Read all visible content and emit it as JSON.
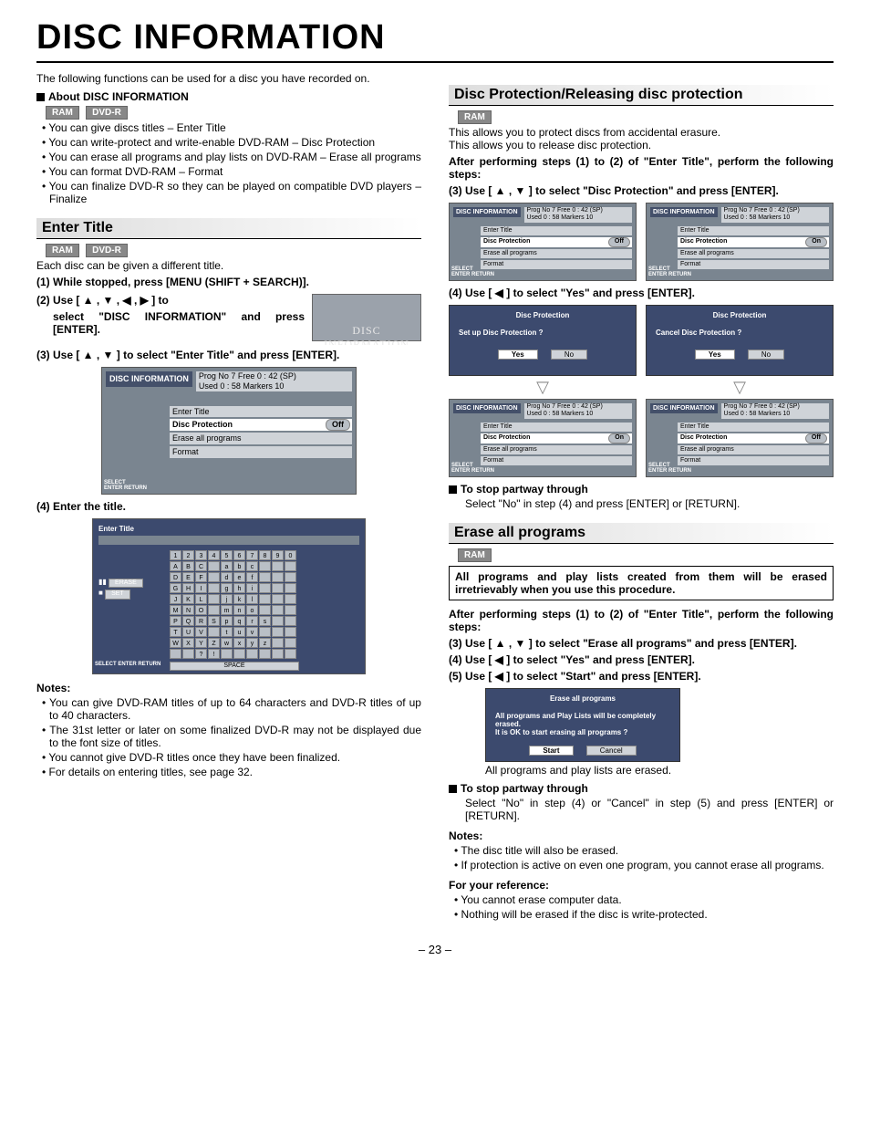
{
  "title": "DISC INFORMATION",
  "intro": "The following functions can be used for a disc you have recorded on.",
  "badges": {
    "ram": "RAM",
    "dvdr": "DVD-R"
  },
  "about": {
    "head": "About DISC INFORMATION",
    "items": [
      "You can give discs titles – Enter Title",
      "You can write-protect and write-enable DVD-RAM – Disc Protection",
      "You can erase all programs and play lists on DVD-RAM – Erase all programs",
      "You can format DVD-RAM – Format",
      "You can finalize DVD-R so they can be played on compatible DVD players – Finalize"
    ]
  },
  "enterTitle": {
    "head": "Enter Title",
    "lead": "Each disc can be given a different title.",
    "s1": "(1) While stopped, press [MENU (SHIFT + SEARCH)].",
    "s2a": "(2) Use [ ▲ , ▼ , ◀ , ▶ ] to",
    "s2b": "select \"DISC INFORMATION\" and press [ENTER].",
    "s3": "(3) Use [ ▲ , ▼ ] to select \"Enter Title\" and press [ENTER].",
    "s4": "(4) Enter the title.",
    "iconLabel": "DISC INFORMATION",
    "notesH": "Notes:",
    "notes": [
      "You can give DVD-RAM titles of up to 64 characters and DVD-R titles of up to 40 characters.",
      "The 31st letter or later on some finalized DVD-R may not be displayed due to the font size of titles.",
      "You cannot give DVD-R titles once they have been finalized.",
      "For details on entering titles, see page 32."
    ]
  },
  "menu": {
    "tag": "DISC INFORMATION",
    "stats1": "Prog No 7      Free        0 : 42 (SP)",
    "stats2": "Used    0 : 58   Markers     10",
    "rows": {
      "enterTitle": "Enter Title",
      "discProt": "Disc Protection",
      "eraseAll": "Erase all programs",
      "format": "Format"
    },
    "off": "Off",
    "on": "On",
    "side": "SELECT\nENTER  RETURN"
  },
  "kb": {
    "title": "Enter Title",
    "erase": "ERASE",
    "set": "SET",
    "space": "SPACE",
    "side": "SELECT\nENTER  RETURN",
    "row1": [
      "1",
      "2",
      "3",
      "4",
      "5",
      "6",
      "7",
      "8",
      "9",
      "0"
    ],
    "row2": [
      "A",
      "B",
      "C",
      "",
      "a",
      "b",
      "c",
      "",
      "",
      ""
    ],
    "row3": [
      "D",
      "E",
      "F",
      "",
      "d",
      "e",
      "f",
      "",
      "",
      ""
    ],
    "row4": [
      "G",
      "H",
      "I",
      "",
      "g",
      "h",
      "i",
      "",
      "",
      ""
    ],
    "row5": [
      "J",
      "K",
      "L",
      "",
      "j",
      "k",
      "l",
      "",
      "",
      ""
    ],
    "row6": [
      "M",
      "N",
      "O",
      "",
      "m",
      "n",
      "o",
      "",
      "",
      ""
    ],
    "row7": [
      "P",
      "Q",
      "R",
      "S",
      "p",
      "q",
      "r",
      "s",
      "",
      ""
    ],
    "row8": [
      "T",
      "U",
      "V",
      "",
      "t",
      "u",
      "v",
      "",
      "",
      ""
    ],
    "row9": [
      "W",
      "X",
      "Y",
      "Z",
      "w",
      "x",
      "y",
      "z",
      "",
      ""
    ],
    "row10": [
      "",
      "",
      "?",
      "!",
      "",
      "",
      "",
      "",
      "",
      ""
    ]
  },
  "discProt": {
    "head": "Disc Protection/Releasing disc protection",
    "lead1": "This allows you to protect discs from accidental erasure.",
    "lead2": "This allows you to release disc protection.",
    "after": "After performing steps (1) to (2) of \"Enter Title\", perform the following steps:",
    "s3": "(3) Use [ ▲ , ▼ ] to select \"Disc Protection\" and press [ENTER].",
    "s4": "(4) Use [ ◀ ] to select \"Yes\" and press [ENTER].",
    "dlg1": {
      "title": "Disc Protection",
      "q": "Set up Disc Protection ?",
      "yes": "Yes",
      "no": "No"
    },
    "dlg2": {
      "title": "Disc Protection",
      "q": "Cancel Disc Protection ?",
      "yes": "Yes",
      "no": "No"
    },
    "stopH": "To stop partway through",
    "stop": "Select \"No\" in step (4) and press [ENTER] or [RETURN]."
  },
  "eraseAll": {
    "head": "Erase all programs",
    "warn": "All programs and play lists created from them will be erased irretrievably when you use this procedure.",
    "after": "After performing steps (1) to (2) of \"Enter Title\", perform the following steps:",
    "s3": "(3) Use [ ▲ , ▼ ] to select \"Erase all programs\" and press [ENTER].",
    "s4": "(4) Use [ ◀ ] to select \"Yes\" and press [ENTER].",
    "s5": "(5) Use [ ◀ ] to select \"Start\" and press [ENTER].",
    "dlg": {
      "title": "Erase all programs",
      "q": "All programs and Play Lists will be completely erased.\nIt is OK to start erasing all programs ?",
      "start": "Start",
      "cancel": "Cancel"
    },
    "result": "All programs and play lists are erased.",
    "stopH": "To stop partway through",
    "stop": "Select \"No\" in step (4) or \"Cancel\" in step (5) and press [ENTER] or [RETURN].",
    "notesH": "Notes:",
    "notes": [
      "The disc title will also be erased.",
      "If protection is active on even one program, you cannot erase all programs."
    ],
    "refH": "For your reference:",
    "refs": [
      "You cannot erase computer data.",
      "Nothing will be erased if the disc is write-protected."
    ]
  },
  "pageNum": "– 23 –"
}
